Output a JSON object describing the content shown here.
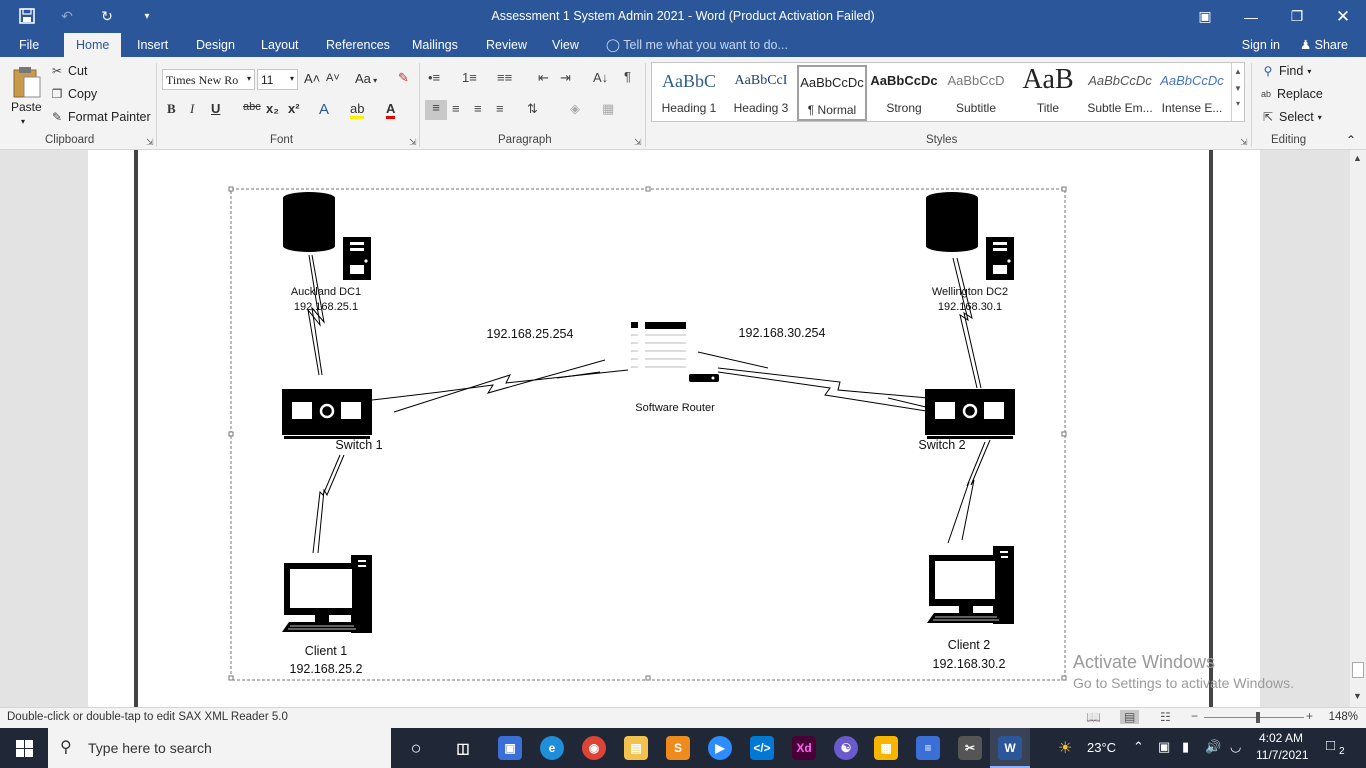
{
  "window": {
    "title": "Assessment 1 System Admin 2021 - Word (Product Activation Failed)"
  },
  "tabs": [
    "File",
    "Home",
    "Insert",
    "Design",
    "Layout",
    "References",
    "Mailings",
    "Review",
    "View"
  ],
  "tellme": "Tell me what you want to do...",
  "account": {
    "signin": "Sign in",
    "share": "Share"
  },
  "clipboard": {
    "paste": "Paste",
    "cut": "Cut",
    "copy": "Copy",
    "format_painter": "Format Painter",
    "label": "Clipboard"
  },
  "font": {
    "name": "Times New Ro",
    "size": "11",
    "label": "Font",
    "change_case": "Aa",
    "bold": "B",
    "italic": "I",
    "underline": "U",
    "strike": "abc",
    "subscript": "x₂",
    "superscript": "x²",
    "grow": "A˄",
    "shrink": "A˅"
  },
  "paragraph": {
    "label": "Paragraph",
    "pilcrow": "¶"
  },
  "styles": {
    "label": "Styles",
    "items": [
      {
        "preview": "AaBbC",
        "name": "Heading 1"
      },
      {
        "preview": "AaBbCcI",
        "name": "Heading 3"
      },
      {
        "preview": "AaBbCcDc",
        "name": "¶ Normal"
      },
      {
        "preview": "AaBbCcDc",
        "name": "Strong"
      },
      {
        "preview": "AaBbCcD",
        "name": "Subtitle"
      },
      {
        "preview": "AaB",
        "name": "Title"
      },
      {
        "preview": "AaBbCcDc",
        "name": "Subtle Em..."
      },
      {
        "preview": "AaBbCcDc",
        "name": "Intense E..."
      }
    ]
  },
  "editing": {
    "label": "Editing",
    "find": "Find",
    "replace": "Replace",
    "select": "Select"
  },
  "diagram": {
    "dc1": {
      "name": "Auckland DC1",
      "ip": "192.168.25.1"
    },
    "dc2": {
      "name": "Wellington DC2",
      "ip": "192.168.30.1"
    },
    "router": {
      "name": "Software Router",
      "ip_left": "192.168.25.254",
      "ip_right": "192.168.30.254"
    },
    "switch1": "Switch 1",
    "switch2": "Switch 2",
    "client1": {
      "name": "Client 1",
      "ip": "192.168.25.2"
    },
    "client2": {
      "name": "Client 2",
      "ip": "192.168.30.2"
    }
  },
  "watermark": {
    "line1": "Activate Windows",
    "line2": "Go to Settings to activate Windows."
  },
  "status": {
    "message": "Double-click or double-tap to edit SAX XML Reader 5.0",
    "zoom": "148%"
  },
  "taskbar": {
    "search_placeholder": "Type here to search",
    "weather": "23°C",
    "time": "4:02 AM",
    "date": "11/7/2021",
    "notifications": "2"
  },
  "colors": {
    "accent": "#2b579a",
    "taskbar": "#202838"
  }
}
